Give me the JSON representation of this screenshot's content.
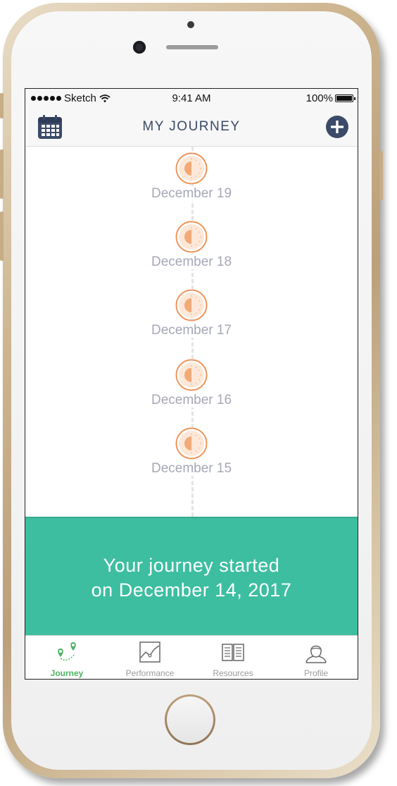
{
  "status_bar": {
    "carrier": "Sketch",
    "time": "9:41 AM",
    "battery": "100%"
  },
  "nav": {
    "title": "MY JOURNEY",
    "left_icon": "calendar-icon",
    "right_icon": "plus-circle-icon"
  },
  "timeline": {
    "entries": [
      {
        "date": "December 19",
        "icon": "sun-icon"
      },
      {
        "date": "December 18",
        "icon": "sun-icon"
      },
      {
        "date": "December 17",
        "icon": "sun-icon"
      },
      {
        "date": "December 16",
        "icon": "sun-icon"
      },
      {
        "date": "December 15",
        "icon": "sun-icon"
      }
    ]
  },
  "banner": {
    "line1": "Your journey started",
    "line2": "on December 14, 2017"
  },
  "tabs": [
    {
      "label": "Journey",
      "icon": "map-pins-icon",
      "active": true
    },
    {
      "label": "Performance",
      "icon": "line-chart-icon",
      "active": false
    },
    {
      "label": "Resources",
      "icon": "book-icon",
      "active": false
    },
    {
      "label": "Profile",
      "icon": "user-icon",
      "active": false
    }
  ],
  "colors": {
    "accent": "#3dbea1",
    "nav_text": "#3b4a68",
    "sun": "#f0955c",
    "date_text": "#a6a8b6",
    "active_tab": "#4bb262"
  }
}
